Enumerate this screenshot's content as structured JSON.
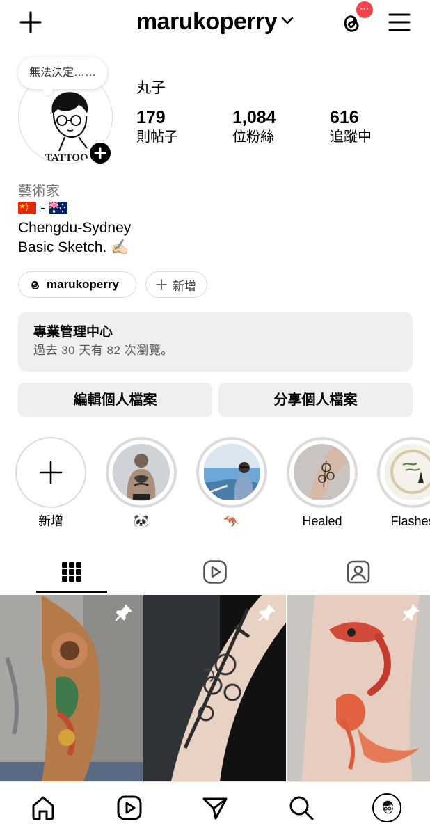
{
  "header": {
    "username": "marukoperry",
    "notification_badge": "···"
  },
  "profile": {
    "note": "無法決定……",
    "avatar_caption": "TATTOO",
    "display_name": "丸子",
    "stats": [
      {
        "value": "179",
        "label": "則帖子"
      },
      {
        "value": "1,084",
        "label": "位粉絲"
      },
      {
        "value": "616",
        "label": "追蹤中"
      }
    ]
  },
  "bio": {
    "category": "藝術家",
    "flags": [
      "cn-flag",
      "au-flag"
    ],
    "flag_separator": "-",
    "lines": [
      "Chengdu-Sydney",
      "Basic Sketch. ✍🏻"
    ]
  },
  "chips": {
    "threads_handle": "marukoperry",
    "add_label": "新增"
  },
  "pro_dashboard": {
    "title": "專業管理中心",
    "subtitle": "過去 30 天有 82 次瀏覽。"
  },
  "actions": {
    "edit_profile": "編輯個人檔案",
    "share_profile": "分享個人檔案"
  },
  "highlights": [
    {
      "label": "新增"
    },
    {
      "label": "🐼"
    },
    {
      "label": "🦘"
    },
    {
      "label": "Healed"
    },
    {
      "label": "Flashes"
    }
  ],
  "tabs": [
    "grid-icon",
    "reels-icon",
    "tagged-icon"
  ],
  "posts": [
    {
      "name": "full-sleeve-tattoo",
      "pinned": true
    },
    {
      "name": "sword-roses-tattoo",
      "pinned": true
    },
    {
      "name": "koi-fish-tattoo",
      "pinned": true
    }
  ],
  "bottom_nav": [
    "home-icon",
    "reels-icon",
    "messages-icon",
    "search-icon",
    "profile-avatar"
  ],
  "colors": {
    "accent_badge": "#f0444a",
    "surface": "#efeff1",
    "border": "#dbdbdb",
    "muted_text": "#737373"
  }
}
